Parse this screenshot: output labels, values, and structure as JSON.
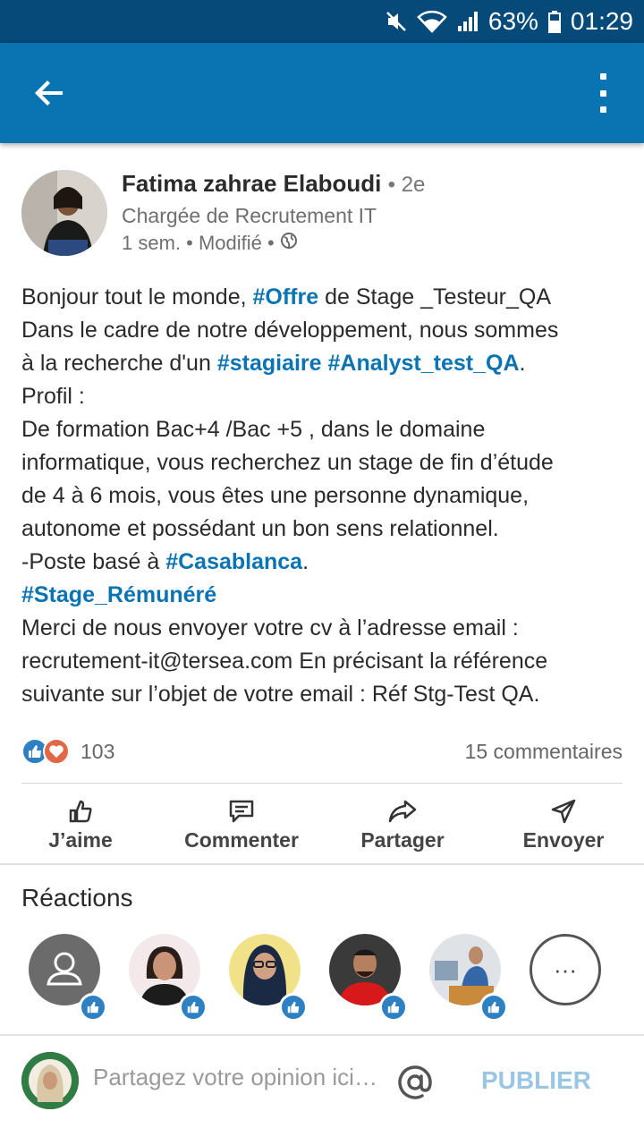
{
  "status_bar": {
    "battery": "63%",
    "time": "01:29"
  },
  "post": {
    "author": {
      "name": "Fatima zahrae Elaboudi",
      "degree": "• 2e",
      "headline": "Chargée de Recrutement IT",
      "meta": "1 sem. • Modifié •"
    },
    "lines": [
      [
        {
          "t": "Bonjour tout le monde, "
        },
        {
          "t": "#Offre",
          "h": true
        },
        {
          "t": " de Stage _Testeur_QA"
        }
      ],
      [
        {
          "t": "Dans le cadre de notre développement, nous sommes"
        }
      ],
      [
        {
          "t": "à la recherche d'un "
        },
        {
          "t": "#stagiaire",
          "h": true
        },
        {
          "t": " "
        },
        {
          "t": "#Analyst_test_QA",
          "h": true
        },
        {
          "t": "."
        }
      ],
      [
        {
          "t": "Profil :"
        }
      ],
      [
        {
          "t": "De formation Bac+4 /Bac +5 , dans le domaine"
        }
      ],
      [
        {
          "t": "informatique, vous recherchez un stage de fin d’étude"
        }
      ],
      [
        {
          "t": "de 4 à 6 mois, vous êtes une personne dynamique,"
        }
      ],
      [
        {
          "t": "autonome et possédant un bon sens relationnel."
        }
      ],
      [
        {
          "t": "-Poste basé à "
        },
        {
          "t": "#Casablanca",
          "h": true
        },
        {
          "t": "."
        }
      ],
      [
        {
          "t": "#Stage_Rémunéré",
          "h": true
        }
      ],
      [
        {
          "t": "Merci de nous envoyer votre cv à l’adresse email :"
        }
      ],
      [
        {
          "t": "recrutement-it@tersea.com En précisant la référence"
        }
      ],
      [
        {
          "t": "suivante sur l’objet de votre email : Réf Stg-Test QA."
        }
      ]
    ],
    "reaction_count": "103",
    "comment_count": "15 commentaires"
  },
  "actions": {
    "like": "J’aime",
    "comment": "Commenter",
    "share": "Partager",
    "send": "Envoyer"
  },
  "reactions": {
    "title": "Réactions",
    "more": "···"
  },
  "composer": {
    "placeholder": "Partagez votre opinion ici…",
    "publish": "PUBLIER"
  },
  "colors": {
    "brand": "#0a73b2",
    "status_bar": "#064a7a",
    "hashtag": "#0a73b2",
    "like_blue": "#2d80c4",
    "love_red": "#e06846",
    "publish_disabled": "#9ac6e4"
  },
  "icons": [
    "back-arrow-icon",
    "more-vert-icon",
    "like-icon",
    "comment-icon",
    "share-icon",
    "send-icon",
    "mention-icon",
    "globe-icon",
    "mute-icon",
    "wifi-icon",
    "signal-icon",
    "battery-icon"
  ]
}
